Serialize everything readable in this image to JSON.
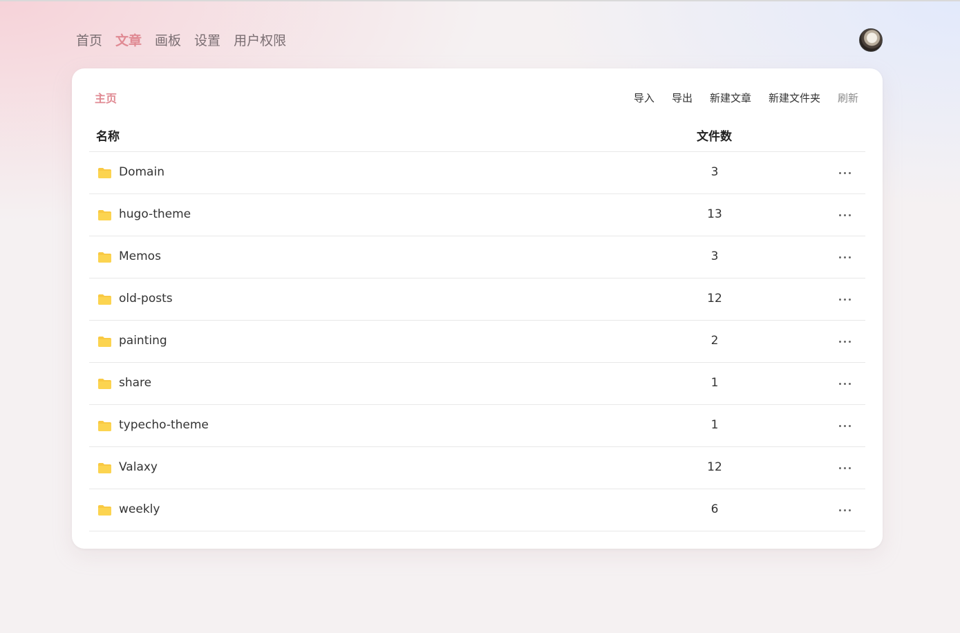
{
  "nav": {
    "items": [
      {
        "label": "首页",
        "active": false
      },
      {
        "label": "文章",
        "active": true
      },
      {
        "label": "画板",
        "active": false
      },
      {
        "label": "设置",
        "active": false
      },
      {
        "label": "用户权限",
        "active": false
      }
    ]
  },
  "breadcrumb": "主页",
  "toolbar": {
    "import_label": "导入",
    "export_label": "导出",
    "new_post_label": "新建文章",
    "new_folder_label": "新建文件夹",
    "refresh_label": "刷新"
  },
  "table": {
    "columns": {
      "name": "名称",
      "count": "文件数"
    },
    "rows": [
      {
        "name": "Domain",
        "count": "3"
      },
      {
        "name": "hugo-theme",
        "count": "13"
      },
      {
        "name": "Memos",
        "count": "3"
      },
      {
        "name": "old-posts",
        "count": "12"
      },
      {
        "name": "painting",
        "count": "2"
      },
      {
        "name": "share",
        "count": "1"
      },
      {
        "name": "typecho-theme",
        "count": "1"
      },
      {
        "name": "Valaxy",
        "count": "12"
      },
      {
        "name": "weekly",
        "count": "6"
      }
    ]
  },
  "colors": {
    "accent": "#e08a93",
    "folder": "#f9c943"
  },
  "icons": {
    "folder": "folder-icon",
    "more": "more-horizontal-icon",
    "avatar": "user-avatar"
  }
}
